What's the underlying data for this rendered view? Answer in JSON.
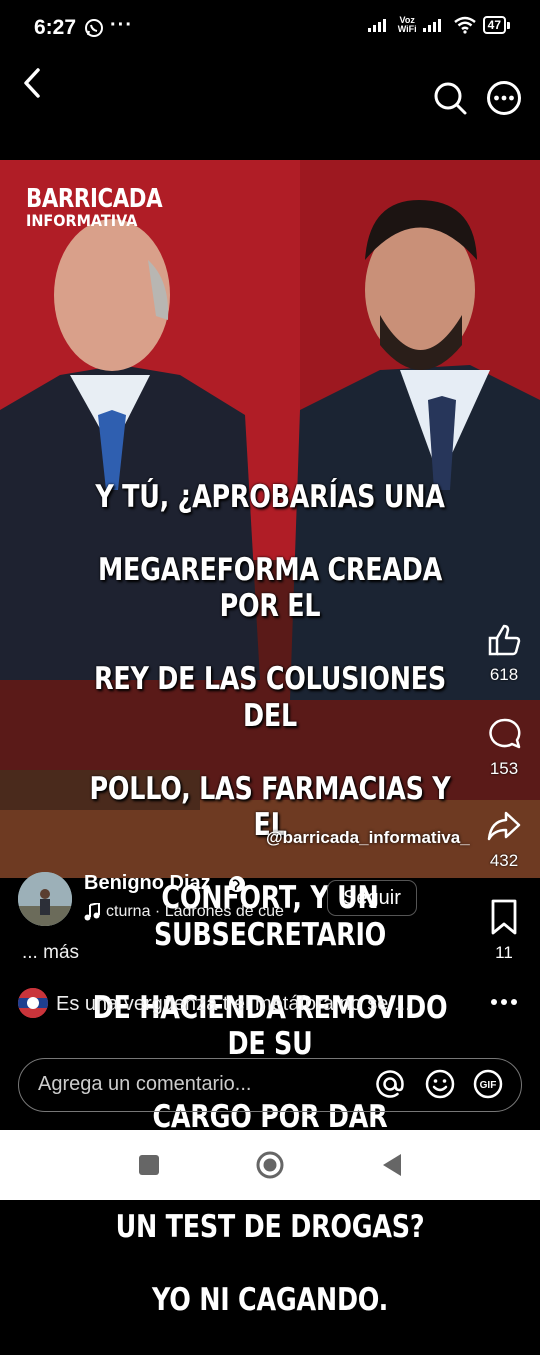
{
  "status_bar": {
    "time": "6:27",
    "dots": "···",
    "voz_line1": "Voz",
    "voz_line2": "WiFi",
    "battery": "47"
  },
  "post": {
    "brand_line1": "BARRICADA",
    "brand_line2": "INFORMATIVA",
    "meme_lines": [
      "Y TÚ, ¿APROBARÍAS UNA",
      "MEGAREFORMA CREADA POR EL",
      "REY DE LAS COLUSIONES DEL",
      "POLLO, LAS FARMACIAS Y EL",
      "CONFORT, Y UN SUBSECRETARIO",
      "DE HACIENDA REMOVIDO DE SU",
      "CARGO POR DAR POSITIVO EN",
      "UN TEST DE DROGAS?",
      "YO NI CAGANDO."
    ],
    "watermark": "@barricada_informativa_"
  },
  "actions": {
    "likes": "618",
    "comments": "153",
    "shares": "432",
    "saves": "11"
  },
  "author": {
    "name": "Benigno Diaz",
    "follow_label": "Seguir",
    "music": "cturna · Ladrones de cue",
    "caption_more": "... más"
  },
  "top_comment": {
    "text": "Es una vergüenza t el metáfora no se ..."
  },
  "comment_input": {
    "placeholder": "Agrega un comentario..."
  },
  "colors": {
    "background": "#000000",
    "poster_red": "#b31f27",
    "nav_bar": "#ffffff"
  }
}
